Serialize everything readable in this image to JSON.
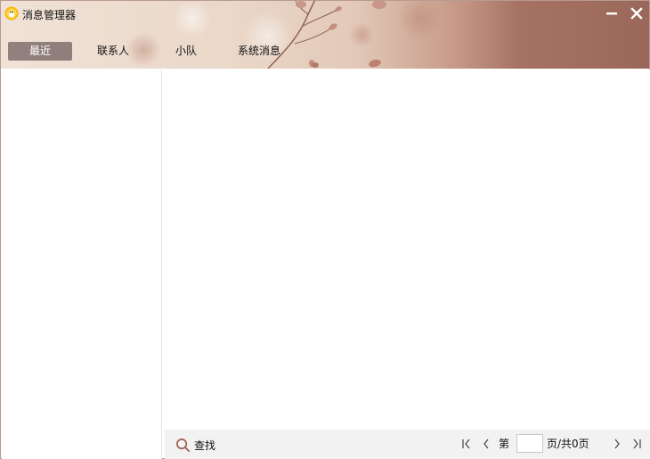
{
  "window": {
    "title": "消息管理器",
    "icon": "qq-penguin-icon",
    "minimize_icon": "minimize-icon",
    "close_icon": "close-icon"
  },
  "tabs": [
    {
      "label": "最近",
      "active": true
    },
    {
      "label": "联系人",
      "active": false
    },
    {
      "label": "小队",
      "active": false
    },
    {
      "label": "系统消息",
      "active": false
    }
  ],
  "footer": {
    "search_label": "查找",
    "search_icon": "search-icon",
    "pager": {
      "first_icon": "first-page-icon",
      "prev_icon": "prev-page-icon",
      "page_prefix": "第",
      "page_value": "",
      "page_suffix": "页/共0页",
      "next_icon": "next-page-icon",
      "last_icon": "last-page-icon"
    }
  },
  "colors": {
    "accent": "#9a685a",
    "active_tab": "#766464",
    "search_icon": "#a06050",
    "footer_bg": "#f2f2f2"
  }
}
